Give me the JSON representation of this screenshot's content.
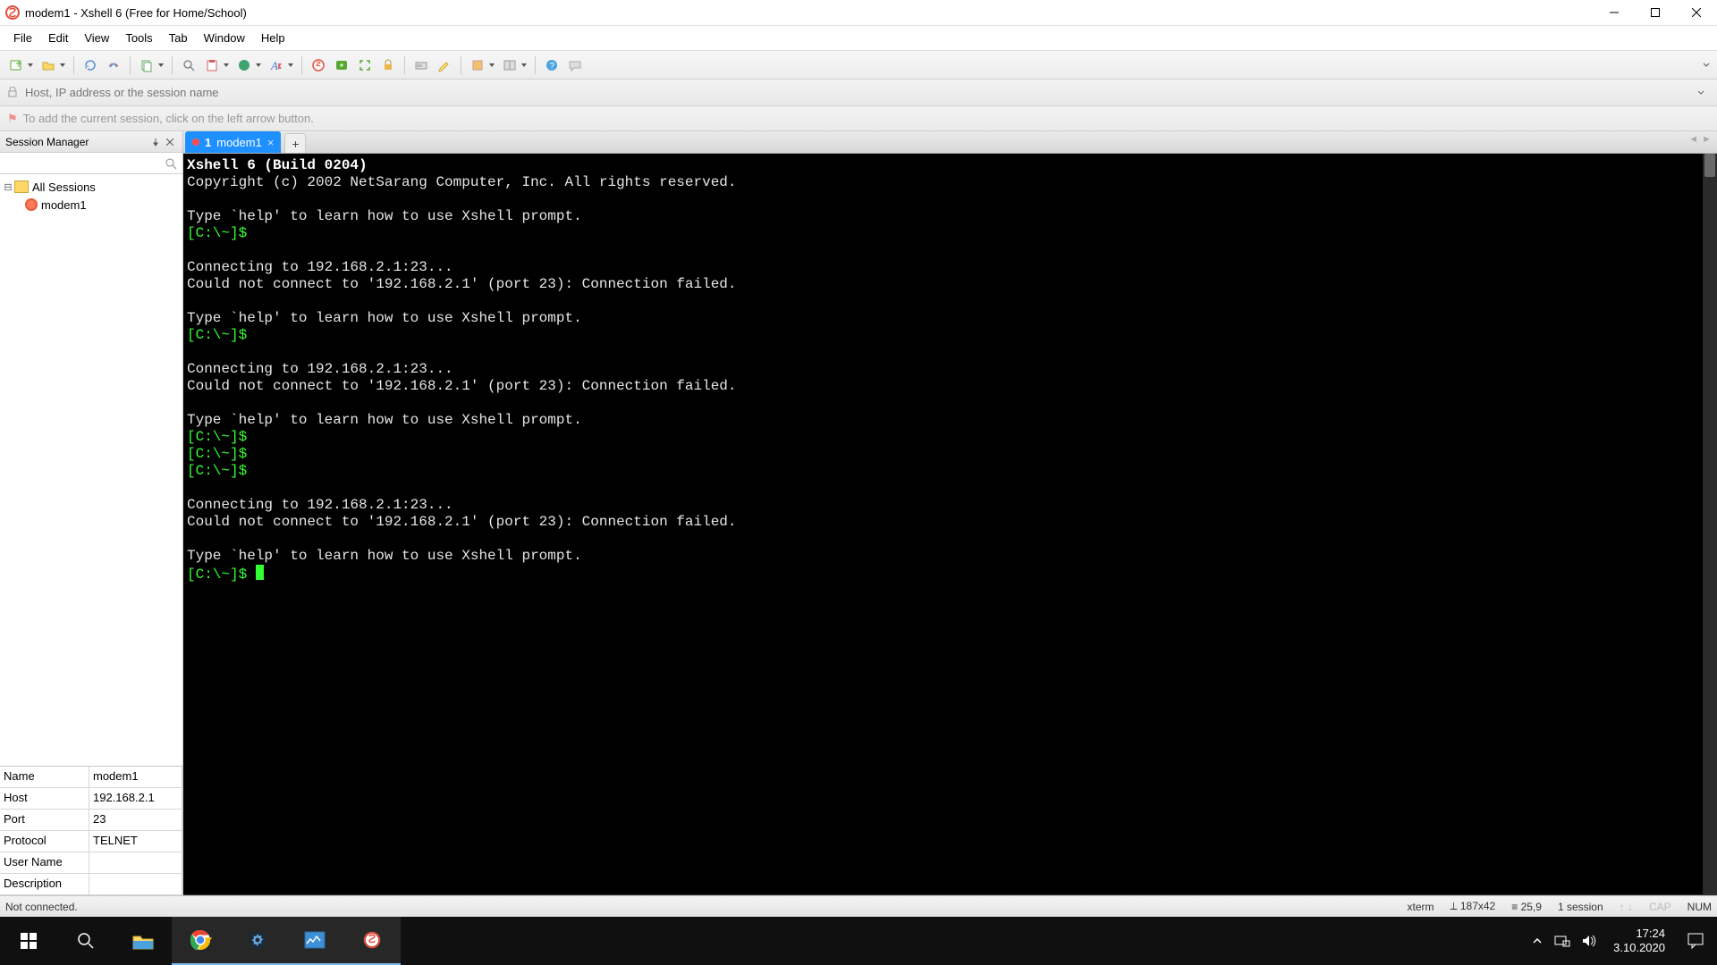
{
  "title": "modem1 - Xshell 6 (Free for Home/School)",
  "menu": [
    "File",
    "Edit",
    "View",
    "Tools",
    "Tab",
    "Window",
    "Help"
  ],
  "addr_placeholder": "Host, IP address or the session name",
  "info_hint": "To add the current session, click on the left arrow button.",
  "session_manager": {
    "title": "Session Manager",
    "root": "All Sessions",
    "items": [
      "modem1"
    ]
  },
  "properties": [
    {
      "k": "Name",
      "v": "modem1"
    },
    {
      "k": "Host",
      "v": "192.168.2.1"
    },
    {
      "k": "Port",
      "v": "23"
    },
    {
      "k": "Protocol",
      "v": "TELNET"
    },
    {
      "k": "User Name",
      "v": ""
    },
    {
      "k": "Description",
      "v": ""
    }
  ],
  "tab": {
    "index": "1",
    "name": "modem1"
  },
  "terminal": {
    "header": "Xshell 6 (Build 0204)",
    "copyright": "Copyright (c) 2002 NetSarang Computer, Inc. All rights reserved.",
    "help": "Type `help' to learn how to use Xshell prompt.",
    "prompt": "[C:\\~]$ ",
    "connecting": "Connecting to 192.168.2.1:23...",
    "failed": "Could not connect to '192.168.2.1' (port 23): Connection failed."
  },
  "status": {
    "left": "Not connected.",
    "term": "xterm",
    "size": "187x42",
    "cursor": "25,9",
    "sessions": "1 session",
    "cap": "CAP",
    "num": "NUM"
  },
  "clock": {
    "time": "17:24",
    "date": "3.10.2020"
  }
}
